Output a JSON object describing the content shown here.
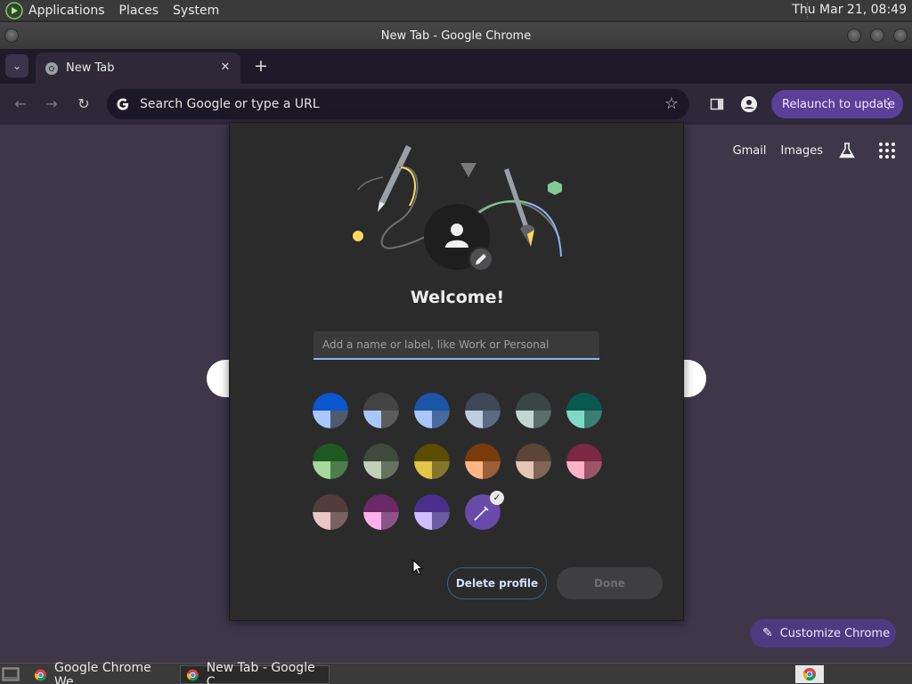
{
  "system_panel": {
    "menus": [
      "Applications",
      "Places",
      "System"
    ],
    "clock": "Thu Mar 21, 08:49"
  },
  "window": {
    "title": "New Tab - Google Chrome"
  },
  "chrome": {
    "tab": {
      "title": "New Tab"
    },
    "omnibox": {
      "placeholder": "Search Google or type a URL"
    },
    "relaunch_label": "Relaunch to update"
  },
  "ntp": {
    "links": [
      "Gmail",
      "Images"
    ],
    "customize_label": "Customize Chrome"
  },
  "dialog": {
    "welcome": "Welcome!",
    "name_placeholder": "Add a name or label, like Work or Personal",
    "delete_label": "Delete profile",
    "done_label": "Done",
    "swatches": [
      {
        "outer": "#0b57d0",
        "inner": "#a8c7fa",
        "dark": "#4f5a6f",
        "selected": false
      },
      {
        "outer": "#444444",
        "inner": "#a8c7fa",
        "dark": "#5d5d5d",
        "selected": false
      },
      {
        "outer": "#1a55a8",
        "inner": "#a8c7fa",
        "dark": "#486aa0",
        "selected": false
      },
      {
        "outer": "#3e4859",
        "inner": "#c2cce0",
        "dark": "#5d6a82",
        "selected": false
      },
      {
        "outer": "#394744",
        "inner": "#c4d6d1",
        "dark": "#5b6e69",
        "selected": false
      },
      {
        "outer": "#08594f",
        "inner": "#80d9c7",
        "dark": "#3b7f74",
        "selected": false
      },
      {
        "outer": "#1f5922",
        "inner": "#a5d99c",
        "dark": "#4d7d4b",
        "selected": false
      },
      {
        "outer": "#3f4a3c",
        "inner": "#c2cfb9",
        "dark": "#65725f",
        "selected": false
      },
      {
        "outer": "#5a4d00",
        "inner": "#e3c547",
        "dark": "#86762b",
        "selected": false
      },
      {
        "outer": "#7a3b0c",
        "inner": "#ffb683",
        "dark": "#9b6038",
        "selected": false
      },
      {
        "outer": "#5c4436",
        "inner": "#e5c6b4",
        "dark": "#806657",
        "selected": false
      },
      {
        "outer": "#7a2843",
        "inner": "#ffb1c5",
        "dark": "#9c5468",
        "selected": false
      },
      {
        "outer": "#533d3c",
        "inner": "#e8c7c4",
        "dark": "#7a6261",
        "selected": false
      },
      {
        "outer": "#6a2a68",
        "inner": "#ffafec",
        "dark": "#8d548a",
        "selected": false
      },
      {
        "outer": "#4a2f8c",
        "inner": "#cdbeff",
        "dark": "#6c5ca3",
        "selected": false
      },
      {
        "outer": "#6a4aa8",
        "inner": "#6a4aa8",
        "dark": "#6a4aa8",
        "selected": true
      }
    ]
  },
  "taskbar": {
    "tasks": [
      "Google Chrome We...",
      "New Tab - Google C..."
    ]
  },
  "colors": {
    "accent": "#5b3f98",
    "page_bg": "#3d3749",
    "dialog_bg": "#2b2b2c"
  }
}
